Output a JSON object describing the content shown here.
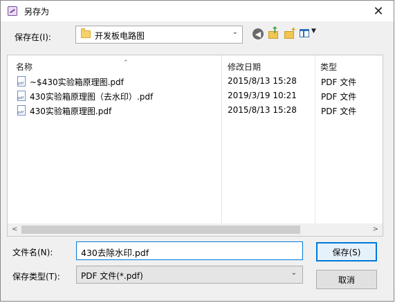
{
  "window": {
    "title": "另存为",
    "close": "✕"
  },
  "location": {
    "label": "保存在(I):",
    "value": "开发板电路图"
  },
  "toolbar": {
    "back_glyph": "◀",
    "view_dropdown_glyph": "▼"
  },
  "file_list": {
    "columns": {
      "name": "名称",
      "modified": "修改日期",
      "type": "类型"
    },
    "rows": [
      {
        "name": "~$430实验箱原理图.pdf",
        "modified": "2015/8/13 15:28",
        "type": "PDF 文件"
      },
      {
        "name": "430实验箱原理图（去水印）.pdf",
        "modified": "2019/3/19 10:21",
        "type": "PDF 文件"
      },
      {
        "name": "430实验箱原理图.pdf",
        "modified": "2015/8/13 15:28",
        "type": "PDF 文件"
      }
    ]
  },
  "filename": {
    "label": "文件名(N):",
    "value": "430去除水印.pdf"
  },
  "filetype": {
    "label": "保存类型(T):",
    "value": "PDF 文件(*.pdf)"
  },
  "buttons": {
    "save": "保存(S)",
    "cancel": "取消"
  },
  "icons": [
    "app-icon",
    "folder-icon",
    "back-icon",
    "up-folder-icon",
    "new-folder-icon",
    "view-menu-icon",
    "pdf-file-icon",
    "close-icon"
  ]
}
